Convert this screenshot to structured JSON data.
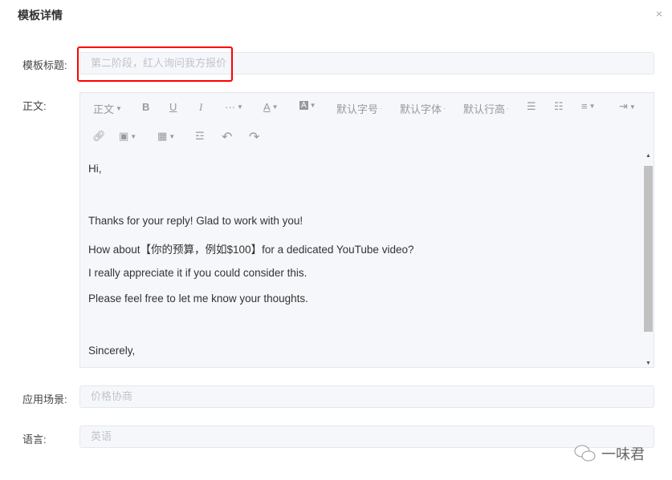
{
  "dialog": {
    "title": "模板详情",
    "close": "×"
  },
  "fields": {
    "title_label": "模板标题:",
    "title_value": "第二阶段，红人询问我方报价",
    "body_label": "正文:",
    "scene_label": "应用场景:",
    "scene_value": "价格协商",
    "lang_label": "语言:",
    "lang_value": "英语"
  },
  "toolbar": {
    "paragraph": "正文",
    "bold": "B",
    "underline": "U",
    "italic": "I",
    "more": "···",
    "color": "A",
    "bg": "A",
    "font_size": "默认字号",
    "font_family": "默认字体",
    "line_height": "默认行高"
  },
  "body_lines": [
    "Hi,",
    "Thanks for your reply! Glad to work with you!",
    "How about【你的预算，例如$100】for a dedicated YouTube video?",
    "I really appreciate it if you could consider this.",
    "Please feel free to let me know your thoughts.",
    "Sincerely,"
  ],
  "watermark": "一味君"
}
